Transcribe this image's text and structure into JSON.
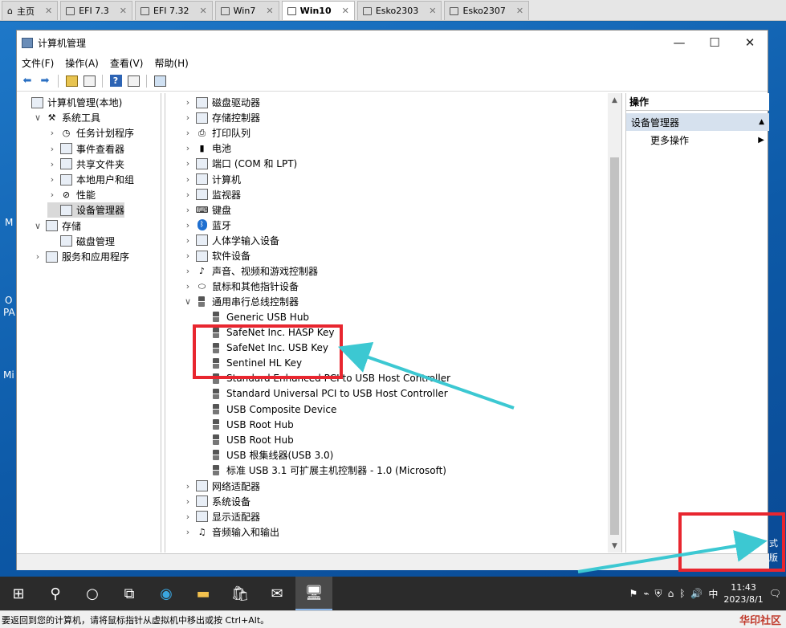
{
  "vm_tabs": [
    {
      "label": "主页",
      "icon": "home-icon",
      "active": false
    },
    {
      "label": "EFI 7.3",
      "icon": "vm-icon",
      "active": false
    },
    {
      "label": "EFI 7.32",
      "icon": "vm-icon",
      "active": false
    },
    {
      "label": "Win7",
      "icon": "vm-icon",
      "active": false
    },
    {
      "label": "Win10",
      "icon": "vm-icon",
      "active": true
    },
    {
      "label": "Esko2303",
      "icon": "vm-icon",
      "active": false
    },
    {
      "label": "Esko2307",
      "icon": "vm-icon",
      "active": false
    }
  ],
  "desktop_labels": [
    "M",
    "O",
    "PA",
    "Mi"
  ],
  "window": {
    "title": "计算机管理",
    "controls": {
      "minimize": "—",
      "maximize": "☐",
      "close": "✕"
    }
  },
  "menu": [
    "文件(F)",
    "操作(A)",
    "查看(V)",
    "帮助(H)"
  ],
  "toolbar_icons": [
    "back-icon",
    "forward-icon",
    "up-folder-icon",
    "properties-icon",
    "help-icon",
    "view-icon",
    "console-icon"
  ],
  "left_tree": [
    {
      "label": "计算机管理(本地)",
      "level": 0,
      "chevron": "",
      "icon": "computer-management-icon",
      "selected": false
    },
    {
      "label": "系统工具",
      "level": 1,
      "chevron": "∨",
      "icon": "tools-icon",
      "selected": false
    },
    {
      "label": "任务计划程序",
      "level": 2,
      "chevron": "›",
      "icon": "clock-icon",
      "selected": false
    },
    {
      "label": "事件查看器",
      "level": 2,
      "chevron": "›",
      "icon": "event-viewer-icon",
      "selected": false
    },
    {
      "label": "共享文件夹",
      "level": 2,
      "chevron": "›",
      "icon": "shared-folder-icon",
      "selected": false
    },
    {
      "label": "本地用户和组",
      "level": 2,
      "chevron": "›",
      "icon": "users-icon",
      "selected": false
    },
    {
      "label": "性能",
      "level": 2,
      "chevron": "›",
      "icon": "performance-icon",
      "selected": false
    },
    {
      "label": "设备管理器",
      "level": 2,
      "chevron": "",
      "icon": "device-manager-icon",
      "selected": true
    },
    {
      "label": "存储",
      "level": 1,
      "chevron": "∨",
      "icon": "storage-icon",
      "selected": false
    },
    {
      "label": "磁盘管理",
      "level": 2,
      "chevron": "",
      "icon": "disk-management-icon",
      "selected": false
    },
    {
      "label": "服务和应用程序",
      "level": 1,
      "chevron": "›",
      "icon": "services-icon",
      "selected": false
    }
  ],
  "device_tree": [
    {
      "label": "磁盘驱动器",
      "level": 0,
      "chevron": "›",
      "icon": "disk-drive-icon"
    },
    {
      "label": "存储控制器",
      "level": 0,
      "chevron": "›",
      "icon": "storage-controller-icon"
    },
    {
      "label": "打印队列",
      "level": 0,
      "chevron": "›",
      "icon": "printer-icon"
    },
    {
      "label": "电池",
      "level": 0,
      "chevron": "›",
      "icon": "battery-icon"
    },
    {
      "label": "端口 (COM 和 LPT)",
      "level": 0,
      "chevron": "›",
      "icon": "port-icon"
    },
    {
      "label": "计算机",
      "level": 0,
      "chevron": "›",
      "icon": "computer-icon"
    },
    {
      "label": "监视器",
      "level": 0,
      "chevron": "›",
      "icon": "monitor-icon"
    },
    {
      "label": "键盘",
      "level": 0,
      "chevron": "›",
      "icon": "keyboard-icon"
    },
    {
      "label": "蓝牙",
      "level": 0,
      "chevron": "›",
      "icon": "bluetooth-icon"
    },
    {
      "label": "人体学输入设备",
      "level": 0,
      "chevron": "›",
      "icon": "hid-icon"
    },
    {
      "label": "软件设备",
      "level": 0,
      "chevron": "›",
      "icon": "software-device-icon"
    },
    {
      "label": "声音、视频和游戏控制器",
      "level": 0,
      "chevron": "›",
      "icon": "sound-icon"
    },
    {
      "label": "鼠标和其他指针设备",
      "level": 0,
      "chevron": "›",
      "icon": "mouse-icon"
    },
    {
      "label": "通用串行总线控制器",
      "level": 0,
      "chevron": "∨",
      "icon": "usb-icon"
    },
    {
      "label": "Generic USB Hub",
      "level": 1,
      "chevron": "",
      "icon": "usb-icon"
    },
    {
      "label": "SafeNet Inc. HASP Key",
      "level": 1,
      "chevron": "",
      "icon": "usb-icon"
    },
    {
      "label": "SafeNet Inc. USB Key",
      "level": 1,
      "chevron": "",
      "icon": "usb-icon"
    },
    {
      "label": "Sentinel HL Key",
      "level": 1,
      "chevron": "",
      "icon": "usb-icon"
    },
    {
      "label": "Standard Enhanced PCI to USB Host Controller",
      "level": 1,
      "chevron": "",
      "icon": "usb-icon"
    },
    {
      "label": "Standard Universal PCI to USB Host Controller",
      "level": 1,
      "chevron": "",
      "icon": "usb-icon"
    },
    {
      "label": "USB Composite Device",
      "level": 1,
      "chevron": "",
      "icon": "usb-icon"
    },
    {
      "label": "USB Root Hub",
      "level": 1,
      "chevron": "",
      "icon": "usb-icon"
    },
    {
      "label": "USB Root Hub",
      "level": 1,
      "chevron": "",
      "icon": "usb-icon"
    },
    {
      "label": "USB 根集线器(USB 3.0)",
      "level": 1,
      "chevron": "",
      "icon": "usb-icon"
    },
    {
      "label": "标准 USB 3.1 可扩展主机控制器 - 1.0 (Microsoft)",
      "level": 1,
      "chevron": "",
      "icon": "usb-icon"
    },
    {
      "label": "网络适配器",
      "level": 0,
      "chevron": "›",
      "icon": "network-adapter-icon"
    },
    {
      "label": "系统设备",
      "level": 0,
      "chevron": "›",
      "icon": "system-device-icon"
    },
    {
      "label": "显示适配器",
      "level": 0,
      "chevron": "›",
      "icon": "display-adapter-icon"
    },
    {
      "label": "音频输入和输出",
      "level": 0,
      "chevron": "›",
      "icon": "audio-icon"
    }
  ],
  "actions": {
    "header": "操作",
    "section": "设备管理器",
    "section_arrow": "▲",
    "items": [
      {
        "label": "更多操作",
        "arrow": "▶"
      }
    ]
  },
  "taskbar": {
    "icons": [
      "windows-start-icon",
      "search-icon",
      "task-view-circle-icon",
      "task-view-icon",
      "edge-icon",
      "file-explorer-icon",
      "store-icon",
      "mail-icon",
      "computer-management-taskbar-icon"
    ],
    "tray_ime": "中",
    "time": "11:43",
    "date": "2023/8/1"
  },
  "overlay_text": [
    "式",
    "版"
  ],
  "vm_status": {
    "message": "要返回到您的计算机，请将鼠标指针从虚拟机中移出或按 Ctrl+Alt。",
    "brand": "华印社区"
  },
  "colors": {
    "highlight": "#e8262f",
    "arrow": "#3cc8d2",
    "selection": "#d9d9d9",
    "action_section": "#d6e1ee"
  }
}
